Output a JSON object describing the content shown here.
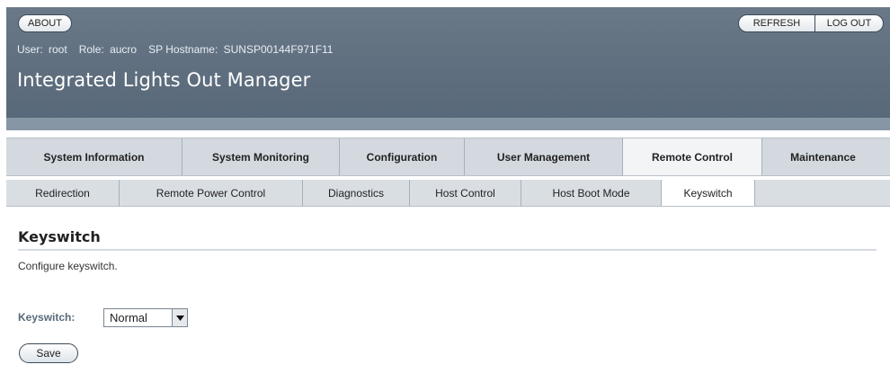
{
  "header": {
    "about_label": "ABOUT",
    "refresh_label": "REFRESH",
    "logout_label": "LOG OUT",
    "user_label": "User:",
    "user_value": "root",
    "role_label": "Role:",
    "role_value": "aucro",
    "hostname_label": "SP Hostname:",
    "hostname_value": "SUNSP00144F971F11",
    "app_title": "Integrated Lights Out Manager"
  },
  "main_tabs": [
    {
      "label": "System Information",
      "active": false
    },
    {
      "label": "System Monitoring",
      "active": false
    },
    {
      "label": "Configuration",
      "active": false
    },
    {
      "label": "User Management",
      "active": false
    },
    {
      "label": "Remote Control",
      "active": true
    },
    {
      "label": "Maintenance",
      "active": false
    }
  ],
  "sub_tabs": [
    {
      "label": "Redirection",
      "active": false
    },
    {
      "label": "Remote Power Control",
      "active": false
    },
    {
      "label": "Diagnostics",
      "active": false
    },
    {
      "label": "Host Control",
      "active": false
    },
    {
      "label": "Host Boot Mode",
      "active": false
    },
    {
      "label": "Keyswitch",
      "active": true
    }
  ],
  "content": {
    "title": "Keyswitch",
    "description": "Configure keyswitch.",
    "keyswitch_label": "Keyswitch:",
    "keyswitch_value": "Normal",
    "save_label": "Save"
  },
  "colors": {
    "banner": "#5d6d7d",
    "tab_bar": "#d3d9df",
    "active_tab": "#f2f4f6"
  },
  "icons": {
    "select_arrow": "dropdown-arrow-icon"
  }
}
